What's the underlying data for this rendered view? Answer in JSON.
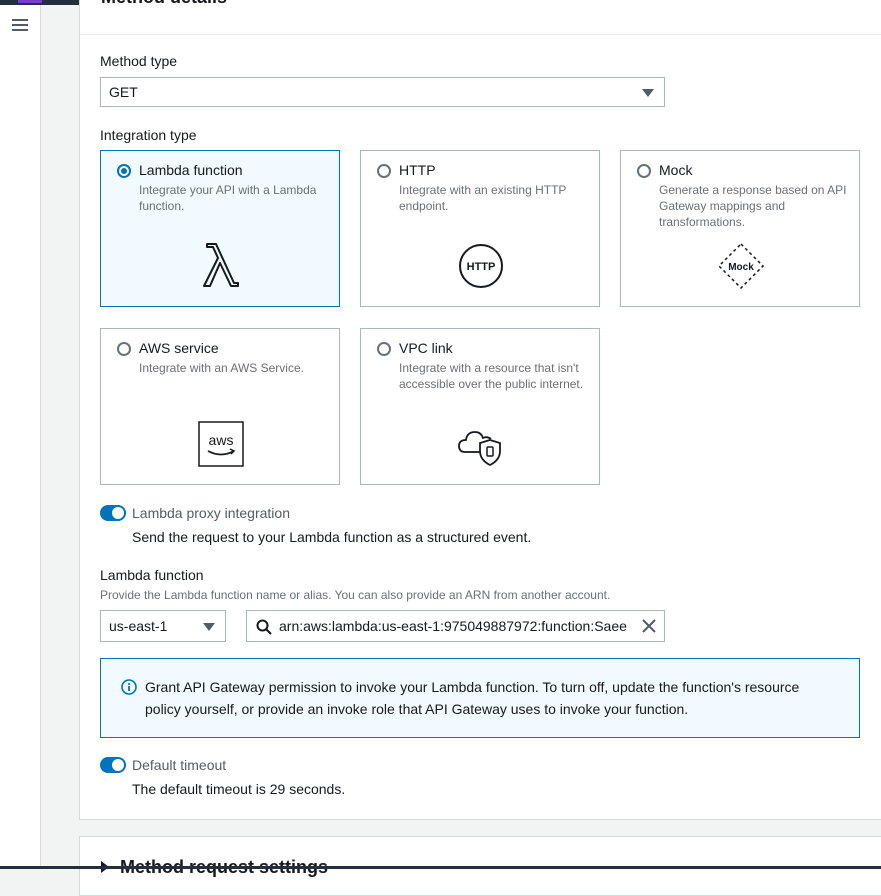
{
  "section": {
    "title": "Method details"
  },
  "method_type": {
    "label": "Method type",
    "value": "GET"
  },
  "integration_type": {
    "label": "Integration type",
    "options": [
      {
        "title": "Lambda function",
        "description": "Integrate your API with a Lambda function.",
        "selected": true,
        "icon": "lambda-icon"
      },
      {
        "title": "HTTP",
        "description": "Integrate with an existing HTTP endpoint.",
        "selected": false,
        "icon": "http-icon",
        "icon_text": "HTTP"
      },
      {
        "title": "Mock",
        "description": "Generate a response based on API Gateway mappings and transformations.",
        "selected": false,
        "icon": "mock-icon",
        "icon_text": "Mock"
      },
      {
        "title": "AWS service",
        "description": "Integrate with an AWS Service.",
        "selected": false,
        "icon": "aws-icon",
        "icon_text": "aws"
      },
      {
        "title": "VPC link",
        "description": "Integrate with a resource that isn't accessible over the public internet.",
        "selected": false,
        "icon": "vpc-cloud-shield-icon"
      }
    ]
  },
  "lambda_proxy": {
    "label": "Lambda proxy integration",
    "description": "Send the request to your Lambda function as a structured event.",
    "enabled": true
  },
  "lambda_function": {
    "label": "Lambda function",
    "description": "Provide the Lambda function name or alias. You can also provide an ARN from another account.",
    "region": "us-east-1",
    "value": "arn:aws:lambda:us-east-1:975049887972:function:Saee"
  },
  "info_alert": {
    "text": "Grant API Gateway permission to invoke your Lambda function. To turn off, update the function's resource policy yourself, or provide an invoke role that API Gateway uses to invoke your function."
  },
  "default_timeout": {
    "label": "Default timeout",
    "description": "The default timeout is 29 seconds.",
    "enabled": true
  },
  "next_section": {
    "title": "Method request settings"
  },
  "colors": {
    "accent": "#0073bb",
    "selected_bg": "#f1faff",
    "border": "#aab7b8",
    "text_secondary": "#687078"
  }
}
